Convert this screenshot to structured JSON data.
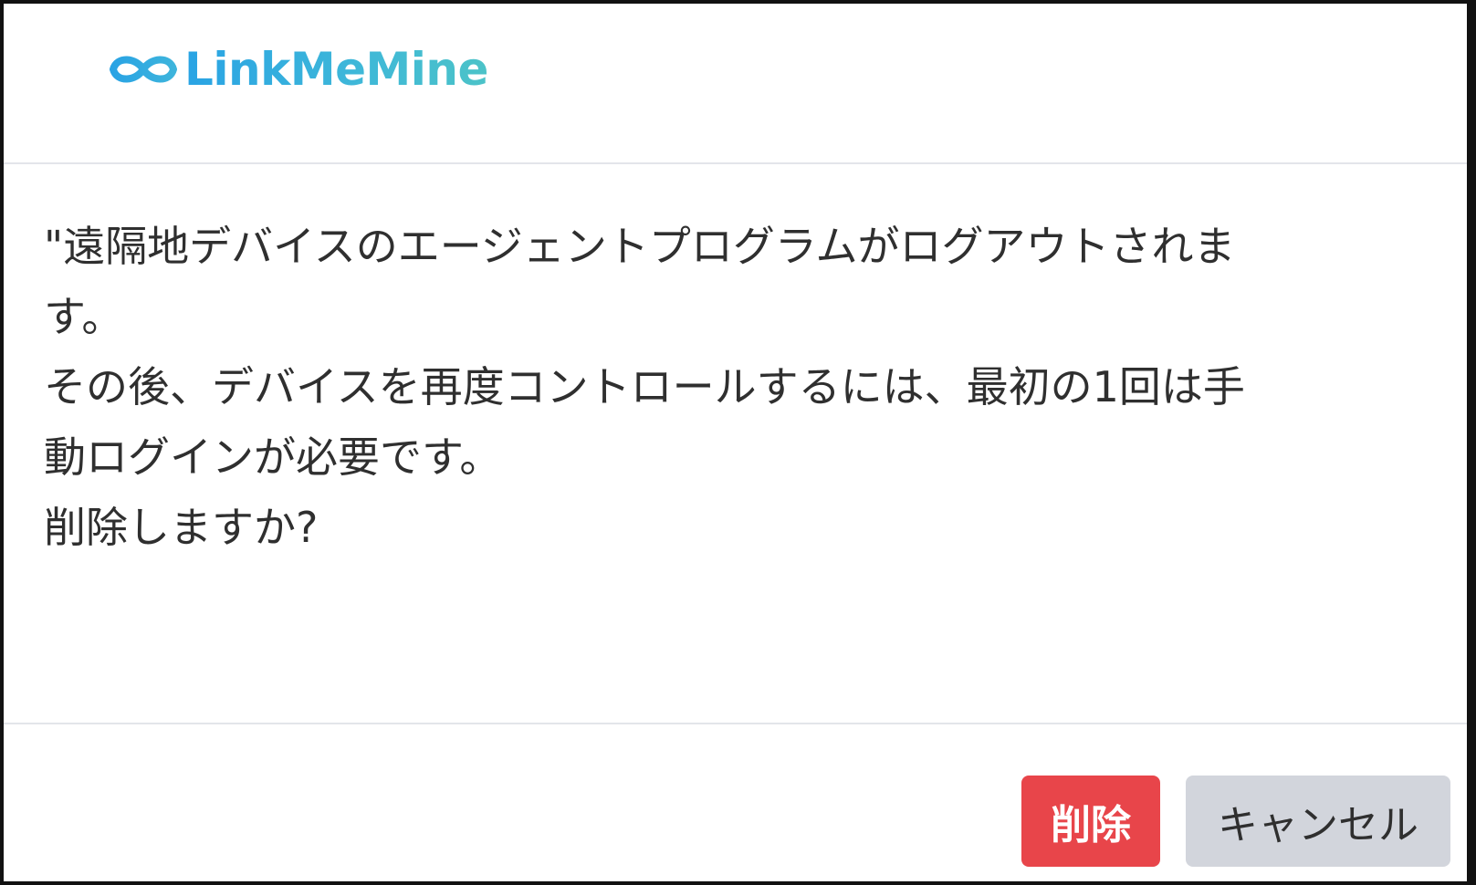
{
  "dialog": {
    "brand": "LinkMeMine",
    "logo_icon": "infinity-icon",
    "message_lines": [
      "\"遠隔地デバイスのエージェントプログラムがログアウトされま",
      "す。",
      "その後、デバイスを再度コントロールするには、最初の1回は手",
      "動ログインが必要です。",
      "削除しますか?"
    ],
    "buttons": {
      "delete_label": "削除",
      "cancel_label": "キャンセル"
    }
  },
  "colors": {
    "brand_blue": "#29a3e4",
    "brand_teal": "#4cc3c8",
    "delete_red": "#e8454a",
    "cancel_gray": "#d2d5dc",
    "text": "#2f2f2f"
  }
}
